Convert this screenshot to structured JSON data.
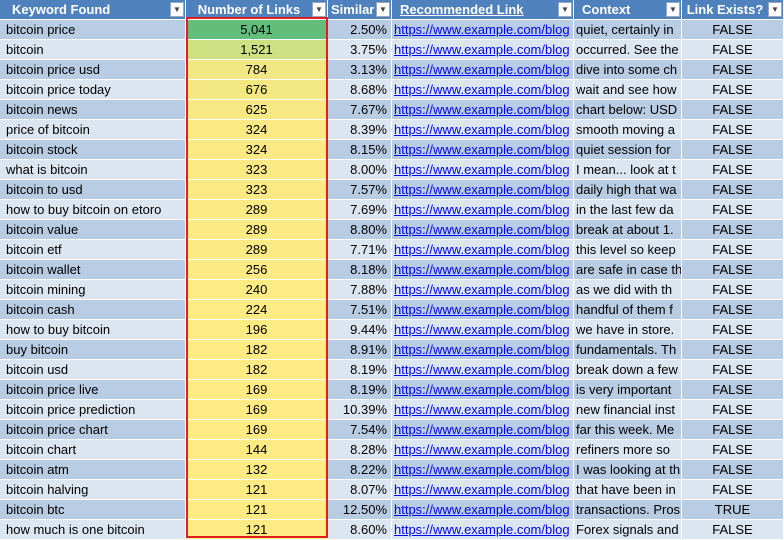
{
  "headers": {
    "keyword": "Keyword Found",
    "links": "Number of Links",
    "similar": "Similar",
    "link": "Recommended Link",
    "context": "Context",
    "exists": "Link Exists?"
  },
  "colors": {
    "header": "#4f81bd",
    "row_light": "#dce6f1",
    "row_dark": "#b8cce4",
    "scale_high": "#63be7b",
    "scale_mid": "#cfe183",
    "scale_low": "#ffeb84",
    "selection_border": "#e02020"
  },
  "rows": [
    {
      "keyword": "bitcoin price",
      "links": "5,041",
      "similar": "2.50%",
      "link": "https://www.example.com/blog",
      "context": "quiet, certainly in",
      "exists": "FALSE",
      "color": "#63be7b"
    },
    {
      "keyword": "bitcoin",
      "links": "1,521",
      "similar": "3.75%",
      "link": "https://www.example.com/blog",
      "context": "occurred. See the",
      "exists": "FALSE",
      "color": "#cfe183"
    },
    {
      "keyword": "bitcoin price usd",
      "links": "784",
      "similar": "3.13%",
      "link": "https://www.example.com/blog",
      "context": "dive into some ch",
      "exists": "FALSE",
      "color": "#f2e883"
    },
    {
      "keyword": "bitcoin price today",
      "links": "676",
      "similar": "8.68%",
      "link": "https://www.example.com/blog",
      "context": "wait and see how",
      "exists": "FALSE",
      "color": "#f4e883"
    },
    {
      "keyword": "bitcoin news",
      "links": "625",
      "similar": "7.67%",
      "link": "https://www.example.com/blog",
      "context": "chart below: USD",
      "exists": "FALSE",
      "color": "#f6e984"
    },
    {
      "keyword": "price of bitcoin",
      "links": "324",
      "similar": "8.39%",
      "link": "https://www.example.com/blog",
      "context": "smooth moving a",
      "exists": "FALSE",
      "color": "#fbea84"
    },
    {
      "keyword": "bitcoin stock",
      "links": "324",
      "similar": "8.15%",
      "link": "https://www.example.com/blog",
      "context": "quiet session for",
      "exists": "FALSE",
      "color": "#fbea84"
    },
    {
      "keyword": "what is bitcoin",
      "links": "323",
      "similar": "8.00%",
      "link": "https://www.example.com/blog",
      "context": "I mean... look at t",
      "exists": "FALSE",
      "color": "#fbea84"
    },
    {
      "keyword": "bitcoin to usd",
      "links": "323",
      "similar": "7.57%",
      "link": "https://www.example.com/blog",
      "context": "daily high that wa",
      "exists": "FALSE",
      "color": "#fbea84"
    },
    {
      "keyword": "how to buy bitcoin on etoro",
      "links": "289",
      "similar": "7.69%",
      "link": "https://www.example.com/blog",
      "context": "in the last few da",
      "exists": "FALSE",
      "color": "#fceb84"
    },
    {
      "keyword": "bitcoin value",
      "links": "289",
      "similar": "8.80%",
      "link": "https://www.example.com/blog",
      "context": "break at about 1.",
      "exists": "FALSE",
      "color": "#fceb84"
    },
    {
      "keyword": "bitcoin etf",
      "links": "289",
      "similar": "7.71%",
      "link": "https://www.example.com/blog",
      "context": "this level so keep",
      "exists": "FALSE",
      "color": "#fceb84"
    },
    {
      "keyword": "bitcoin wallet",
      "links": "256",
      "similar": "8.18%",
      "link": "https://www.example.com/blog",
      "context": "are safe in case th",
      "exists": "FALSE",
      "color": "#fceb84"
    },
    {
      "keyword": "bitcoin mining",
      "links": "240",
      "similar": "7.88%",
      "link": "https://www.example.com/blog",
      "context": "as we did with th",
      "exists": "FALSE",
      "color": "#fdeb84"
    },
    {
      "keyword": "bitcoin cash",
      "links": "224",
      "similar": "7.51%",
      "link": "https://www.example.com/blog",
      "context": "handful of them f",
      "exists": "FALSE",
      "color": "#fdeb84"
    },
    {
      "keyword": "how to buy bitcoin",
      "links": "196",
      "similar": "9.44%",
      "link": "https://www.example.com/blog",
      "context": "we have in store.",
      "exists": "FALSE",
      "color": "#fdeb84"
    },
    {
      "keyword": "buy bitcoin",
      "links": "182",
      "similar": "8.91%",
      "link": "https://www.example.com/blog",
      "context": "fundamentals. Th",
      "exists": "FALSE",
      "color": "#feeb84"
    },
    {
      "keyword": "bitcoin usd",
      "links": "182",
      "similar": "8.19%",
      "link": "https://www.example.com/blog",
      "context": "break down a few",
      "exists": "FALSE",
      "color": "#feeb84"
    },
    {
      "keyword": "bitcoin price live",
      "links": "169",
      "similar": "8.19%",
      "link": "https://www.example.com/blog",
      "context": "is very important",
      "exists": "FALSE",
      "color": "#feeb84"
    },
    {
      "keyword": "bitcoin price prediction",
      "links": "169",
      "similar": "10.39%",
      "link": "https://www.example.com/blog",
      "context": "new financial inst",
      "exists": "FALSE",
      "color": "#feeb84"
    },
    {
      "keyword": "bitcoin price chart",
      "links": "169",
      "similar": "7.54%",
      "link": "https://www.example.com/blog",
      "context": "far this week. Me",
      "exists": "FALSE",
      "color": "#feeb84"
    },
    {
      "keyword": "bitcoin chart",
      "links": "144",
      "similar": "8.28%",
      "link": "https://www.example.com/blog",
      "context": "refiners more so",
      "exists": "FALSE",
      "color": "#feeb84"
    },
    {
      "keyword": "bitcoin atm",
      "links": "132",
      "similar": "8.22%",
      "link": "https://www.example.com/blog",
      "context": "I was looking at th",
      "exists": "FALSE",
      "color": "#ffeb84"
    },
    {
      "keyword": "bitcoin halving",
      "links": "121",
      "similar": "8.07%",
      "link": "https://www.example.com/blog",
      "context": "that have been in",
      "exists": "FALSE",
      "color": "#ffeb84"
    },
    {
      "keyword": "bitcoin btc",
      "links": "121",
      "similar": "12.50%",
      "link": "https://www.example.com/blog",
      "context": "transactions. Pros",
      "exists": "TRUE",
      "color": "#ffeb84"
    },
    {
      "keyword": "how much is one bitcoin",
      "links": "121",
      "similar": "8.60%",
      "link": "https://www.example.com/blog",
      "context": "Forex signals and",
      "exists": "FALSE",
      "color": "#ffeb84"
    }
  ]
}
